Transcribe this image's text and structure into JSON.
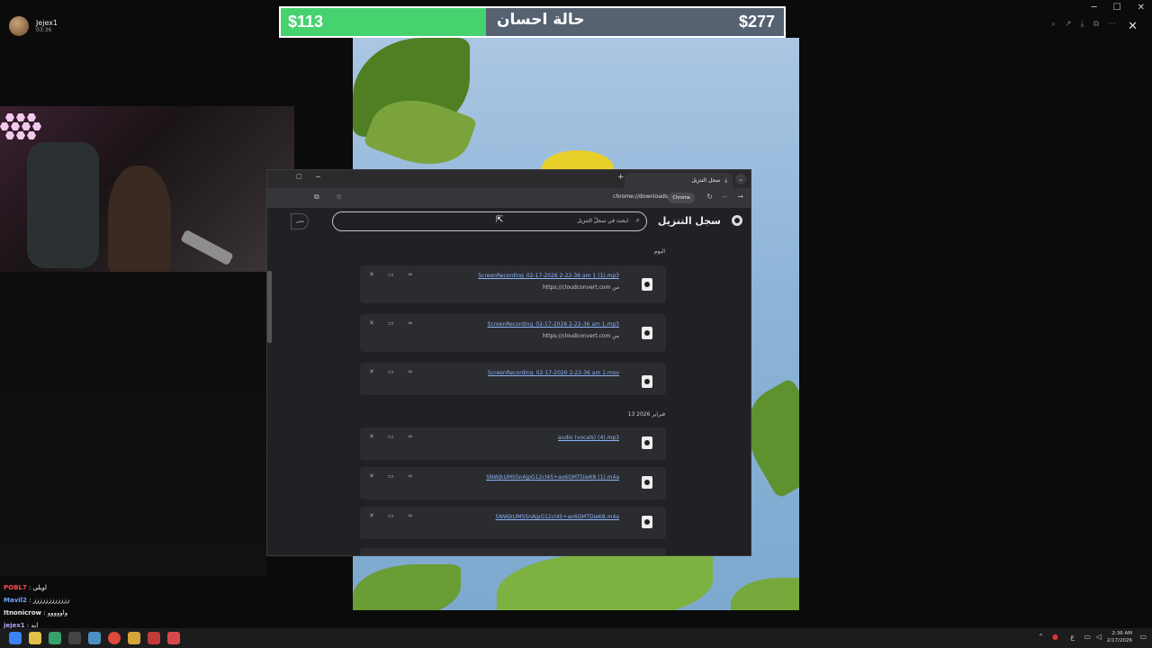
{
  "streamer": {
    "name": "Jejex1",
    "time": "03:36"
  },
  "donation": {
    "current": "$113",
    "goal": "$277",
    "title": "حالة احسان",
    "progress_fraction": 0.408,
    "fill_color": "#46d26f",
    "bar_color": "#566272"
  },
  "chrome": {
    "tab_title": "سجل التنزيل",
    "url": "chrome://downloads",
    "chrome_chip": "Chrome",
    "page_title": "سجل التنزيل",
    "search_placeholder": "ابحث في سجلّ التنزيل",
    "left_pill": "مس",
    "sections": {
      "today": "اليوم",
      "feb13": "13 فبراير 2026"
    },
    "downloads_today": [
      {
        "name": "ScreenRecording_02-17-2026 2-22-36 am 1 (1).mp3",
        "source": "https://cloudconvert.com من"
      },
      {
        "name": "ScreenRecording_02-17-2026 2-22-36 am 1.mp3",
        "source": "https://cloudconvert.com من"
      },
      {
        "name": "ScreenRecording_02-17-2026 2-22-36 am 1.mov",
        "source": ""
      }
    ],
    "downloads_feb13": [
      {
        "name": "audio (vocals) (4).mp3"
      },
      {
        "name": "SNWjkUMSSnAjpG12cl4S+ao6GMTDieK8 (1).m4a"
      },
      {
        "name": "SNWjkUMSSnAjpG12cl4S+ao6GMTDieK8.m4a"
      }
    ]
  },
  "chat": [
    {
      "user": "POBL7",
      "text": ": اويلي",
      "color": "#ff4a4a"
    },
    {
      "user": "Mavil2",
      "text": ": زززززززززززز",
      "color": "#6fa8ff"
    },
    {
      "user": "Itnonicrow",
      "text": ": واووووو",
      "color": "#e8e8e8"
    },
    {
      "user": "jejex1",
      "text": ": ابه",
      "color": "#b5a3ff"
    }
  ],
  "tray": {
    "time": "2:36 AM",
    "date": "2/17/2026"
  },
  "icons": {
    "search": "search-icon",
    "close": "close-icon",
    "link": "link-icon",
    "folder": "folder-icon",
    "file": "file-icon"
  }
}
